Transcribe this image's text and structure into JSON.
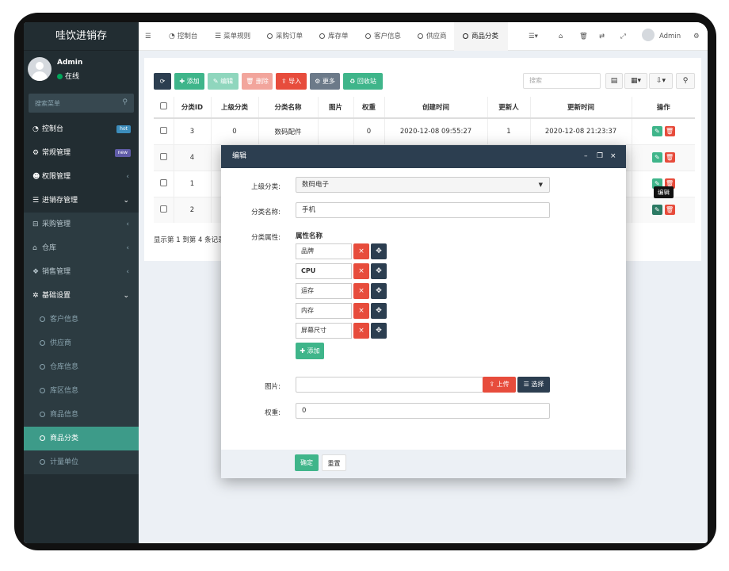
{
  "app": {
    "title": "哇饮进销存"
  },
  "user": {
    "name": "Admin",
    "status": "在线"
  },
  "sidebar": {
    "search_placeholder": "搜索菜单",
    "items": [
      {
        "label": "控制台",
        "icon": "dashboard-icon",
        "badge": "hot"
      },
      {
        "label": "常规管理",
        "icon": "cogs-icon",
        "badge": "new"
      },
      {
        "label": "权限管理",
        "icon": "users-icon",
        "chevron": "‹"
      },
      {
        "label": "进销存管理",
        "icon": "list-icon",
        "chevron": "⌄"
      },
      {
        "label": "采购管理",
        "icon": "basket-icon",
        "chevron": "‹"
      },
      {
        "label": "仓库",
        "icon": "bank-icon",
        "chevron": "‹"
      },
      {
        "label": "销售管理",
        "icon": "cubes-icon",
        "chevron": "‹"
      },
      {
        "label": "基础设置",
        "icon": "gear-icon",
        "chevron": "⌄"
      }
    ],
    "subitems": [
      "客户信息",
      "供应商",
      "仓库信息",
      "库区信息",
      "商品信息",
      "商品分类",
      "计量单位"
    ]
  },
  "topnav": {
    "tabs": [
      "控制台",
      "菜单规则",
      "采购订单",
      "库存单",
      "客户信息",
      "供应商",
      "商品分类"
    ],
    "user": "Admin"
  },
  "toolbar": {
    "add": "添加",
    "edit": "编辑",
    "delete": "删除",
    "import": "导入",
    "more": "更多",
    "recycle": "回收站",
    "search_placeholder": "搜索"
  },
  "table": {
    "headers": [
      "分类ID",
      "上级分类",
      "分类名称",
      "图片",
      "权重",
      "创建时间",
      "更新人",
      "更新时间",
      "操作"
    ],
    "rows": [
      {
        "id": "3",
        "parent": "0",
        "name": "数码配件",
        "weight": "0",
        "created": "2020-12-08 09:55:27",
        "updater": "1",
        "updated": "2020-12-08 21:23:37"
      },
      {
        "id": "4"
      },
      {
        "id": "1"
      },
      {
        "id": "2"
      }
    ],
    "footer": "显示第 1 到第 4 条记录",
    "tooltip": "编辑"
  },
  "modal": {
    "title": "编辑",
    "labels": {
      "parent": "上级分类:",
      "name": "分类名称:",
      "attrs": "分类属性:",
      "image": "图片:",
      "weight": "权重:"
    },
    "parent_value": "数码电子",
    "name_value": "手机",
    "attr_header": "属性名称",
    "attrs": [
      "品牌",
      "CPU",
      "运存",
      "内存",
      "屏幕尺寸"
    ],
    "add_attr": "添加",
    "upload": "上传",
    "choose": "选择",
    "weight_value": "0",
    "confirm": "确定",
    "reset": "重置"
  },
  "colors": {
    "sidebar": "#222d32",
    "accent": "#3d9b89",
    "danger": "#e74c3c",
    "navy": "#2c3e50",
    "success": "#3fb58a"
  }
}
